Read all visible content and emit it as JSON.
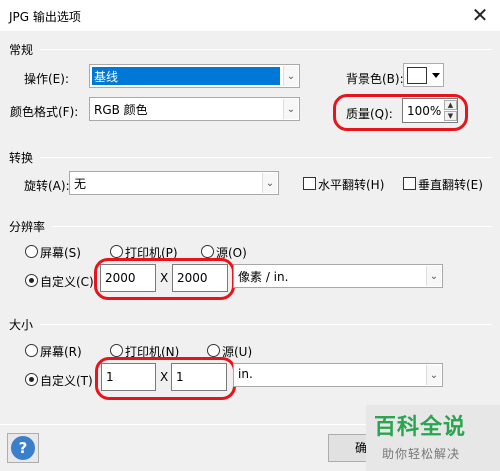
{
  "window": {
    "title": "JPG 输出选项",
    "close_glyph": "✕"
  },
  "general": {
    "section": "常规",
    "operation_label": "操作(E):",
    "operation_value": "基线",
    "color_format_label": "颜色格式(F):",
    "color_format_value": "RGB 颜色",
    "background_label": "背景色(B):",
    "quality_label": "质量(Q):",
    "quality_value": "100%"
  },
  "transform": {
    "section": "转换",
    "rotate_label": "旋转(A):",
    "rotate_value": "无",
    "flip_h_label": "水平翻转(H)",
    "flip_v_label": "垂直翻转(E)"
  },
  "resolution": {
    "section": "分辨率",
    "screen_label": "屏幕(S)",
    "printer_label": "打印机(P)",
    "source_label": "源(O)",
    "custom_label": "自定义(C)",
    "width_value": "2000",
    "x_label": "X",
    "height_value": "2000",
    "unit_value": "像素 / in."
  },
  "size": {
    "section": "大小",
    "screen_label": "屏幕(R)",
    "printer_label": "打印机(N)",
    "source_label": "源(U)",
    "custom_label": "自定义(T)",
    "width_value": "1",
    "x_label": "X",
    "height_value": "1",
    "unit_value": "in."
  },
  "footer": {
    "help_glyph": "?",
    "ok_label": "确定"
  },
  "watermark": {
    "title": "百科全说",
    "subtitle": "助你轻松解决"
  },
  "colors": {
    "highlight_ring": "#e8141b",
    "selection": "#0078d7",
    "watermark_green": "#2aa44f"
  }
}
